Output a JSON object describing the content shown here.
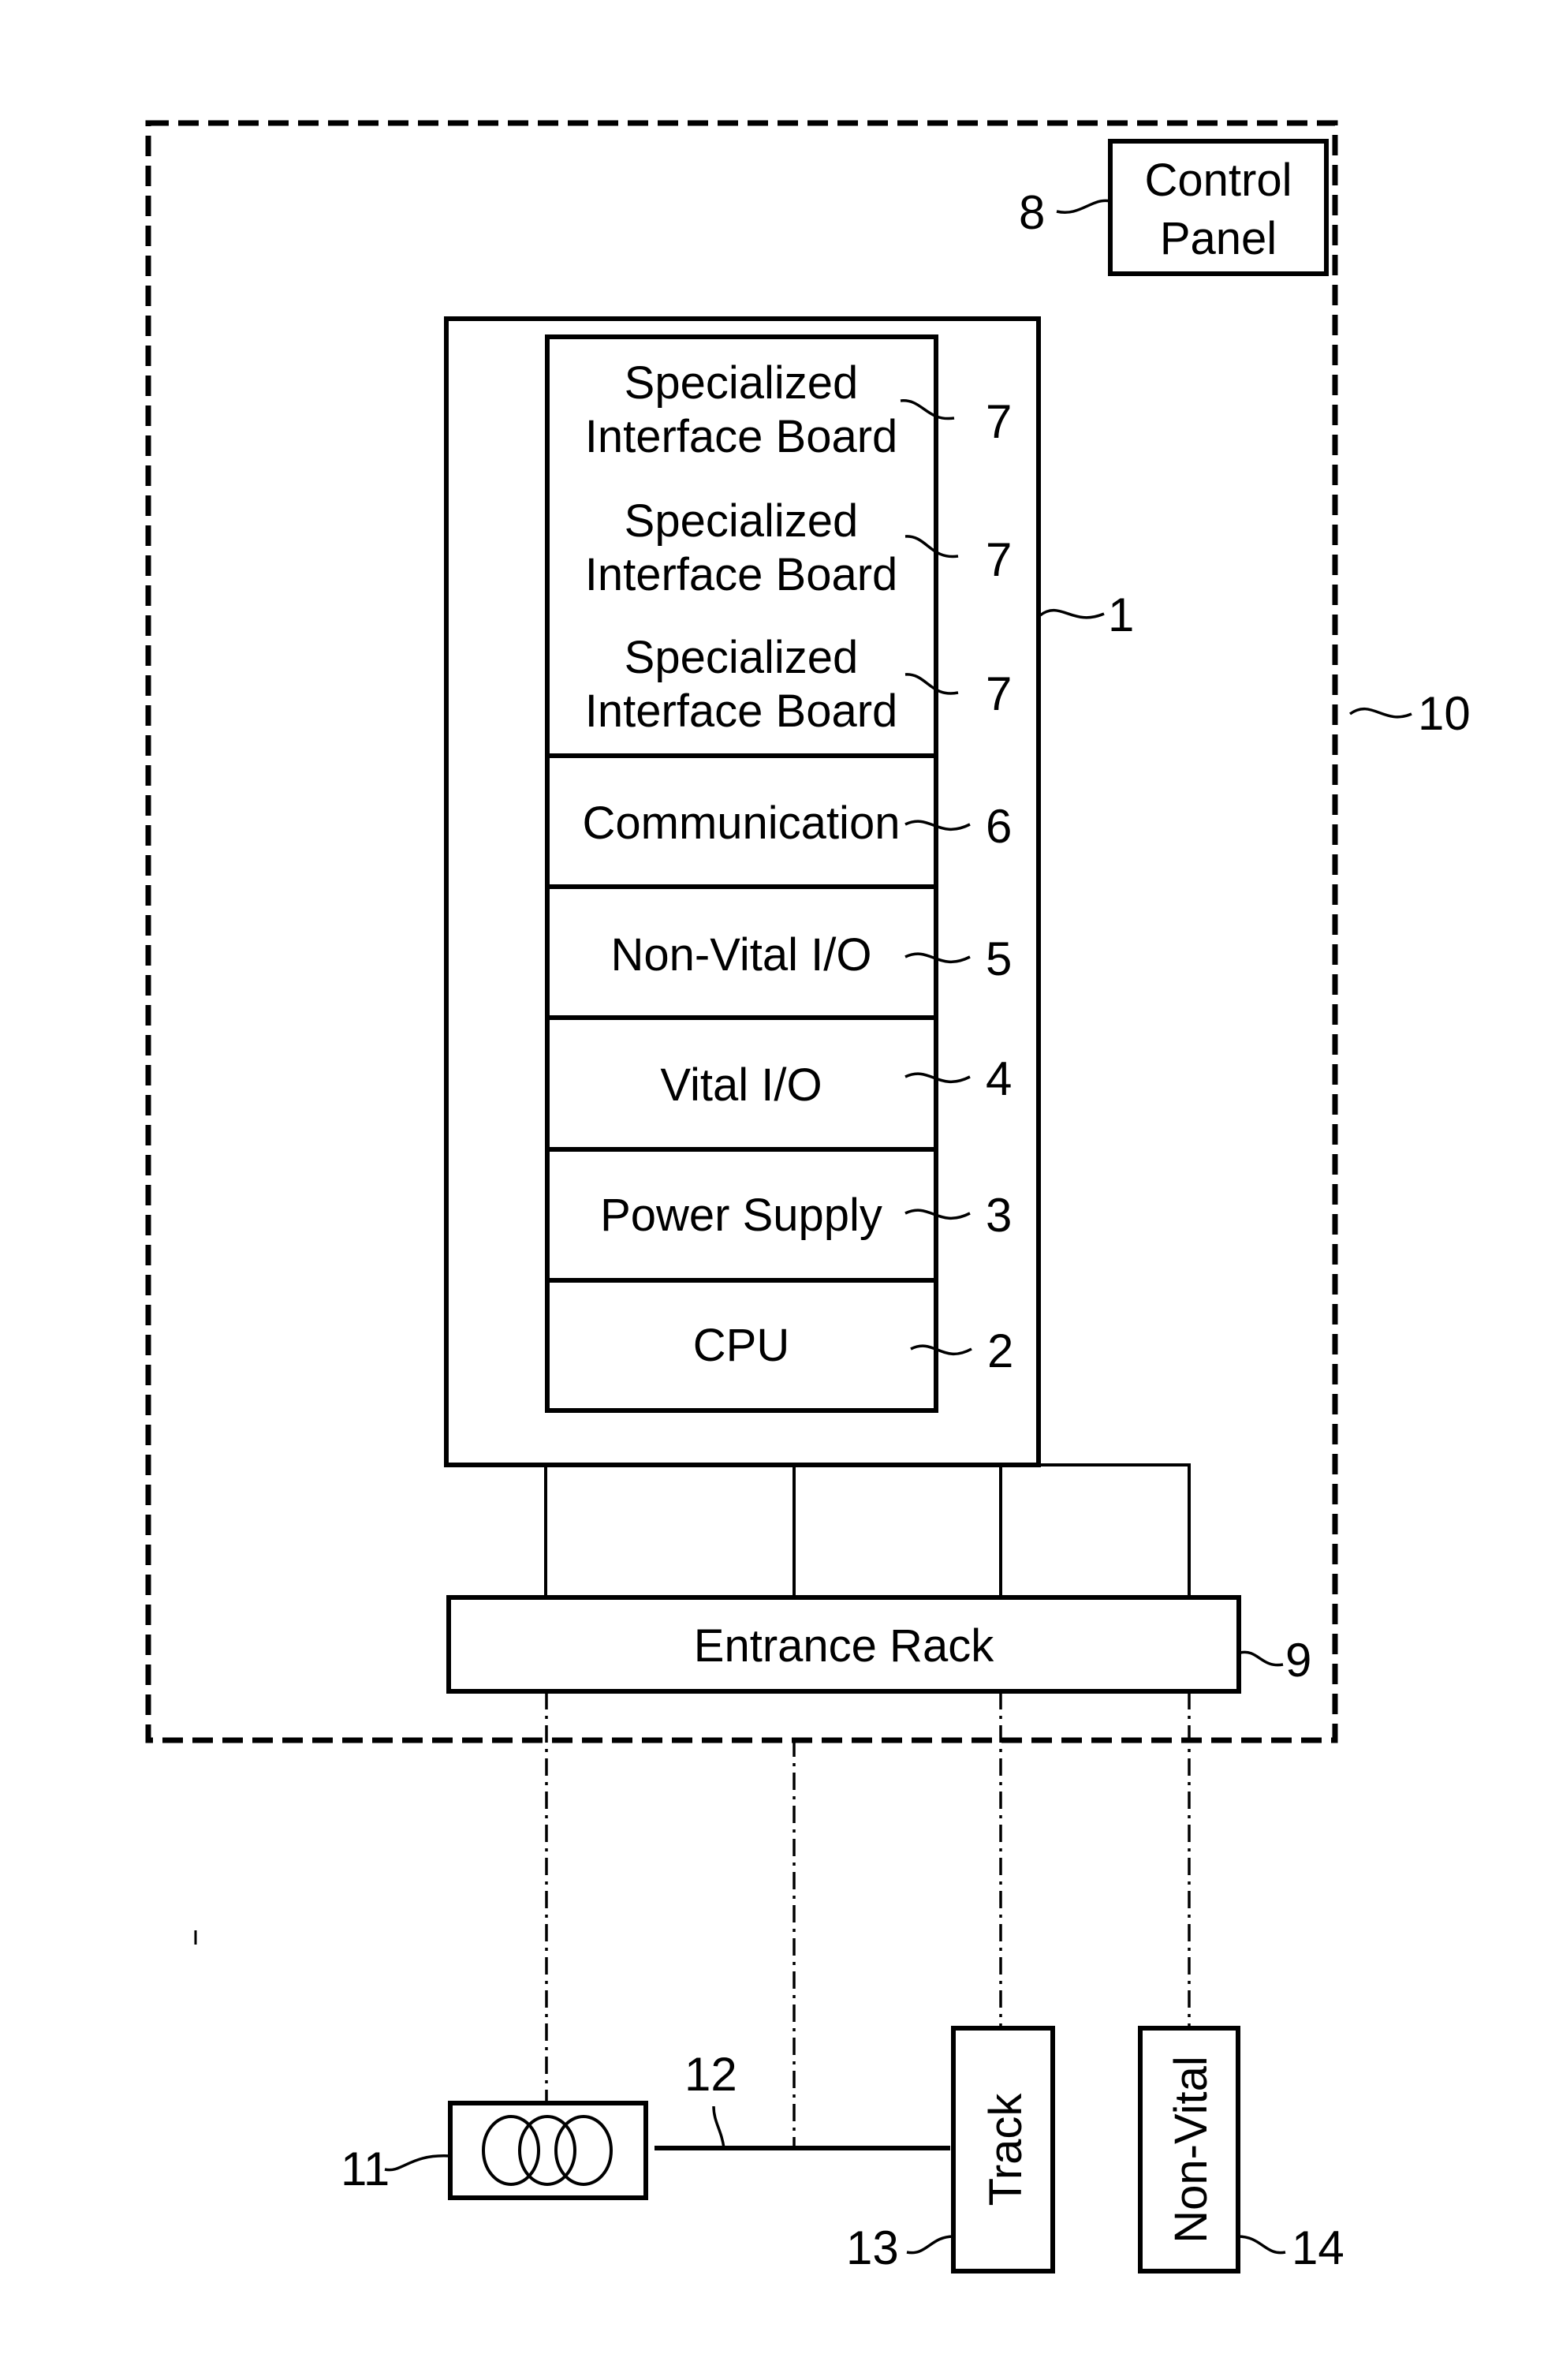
{
  "figure": {
    "enclosure": {
      "ref": "10"
    },
    "control_panel": {
      "label_line1": "Control",
      "label_line2": "Panel",
      "ref": "8"
    },
    "rack": {
      "ref": "1"
    },
    "boards": [
      {
        "line1": "Specialized",
        "line2": "Interface Board",
        "ref": "7"
      },
      {
        "line1": "Specialized",
        "line2": "Interface Board",
        "ref": "7"
      },
      {
        "line1": "Specialized",
        "line2": "Interface Board",
        "ref": "7"
      },
      {
        "label": "Communication",
        "ref": "6"
      },
      {
        "label": "Non-Vital I/O",
        "ref": "5"
      },
      {
        "label": "Vital I/O",
        "ref": "4"
      },
      {
        "label": "Power Supply",
        "ref": "3"
      },
      {
        "label": "CPU",
        "ref": "2"
      }
    ],
    "entrance_rack": {
      "label": "Entrance Rack",
      "ref": "9"
    },
    "signal": {
      "ref": "11",
      "lamp_count": 3
    },
    "line": {
      "ref": "12"
    },
    "track": {
      "label": "Track",
      "ref": "13"
    },
    "non_vital": {
      "label": "Non-Vital",
      "ref": "14"
    }
  }
}
